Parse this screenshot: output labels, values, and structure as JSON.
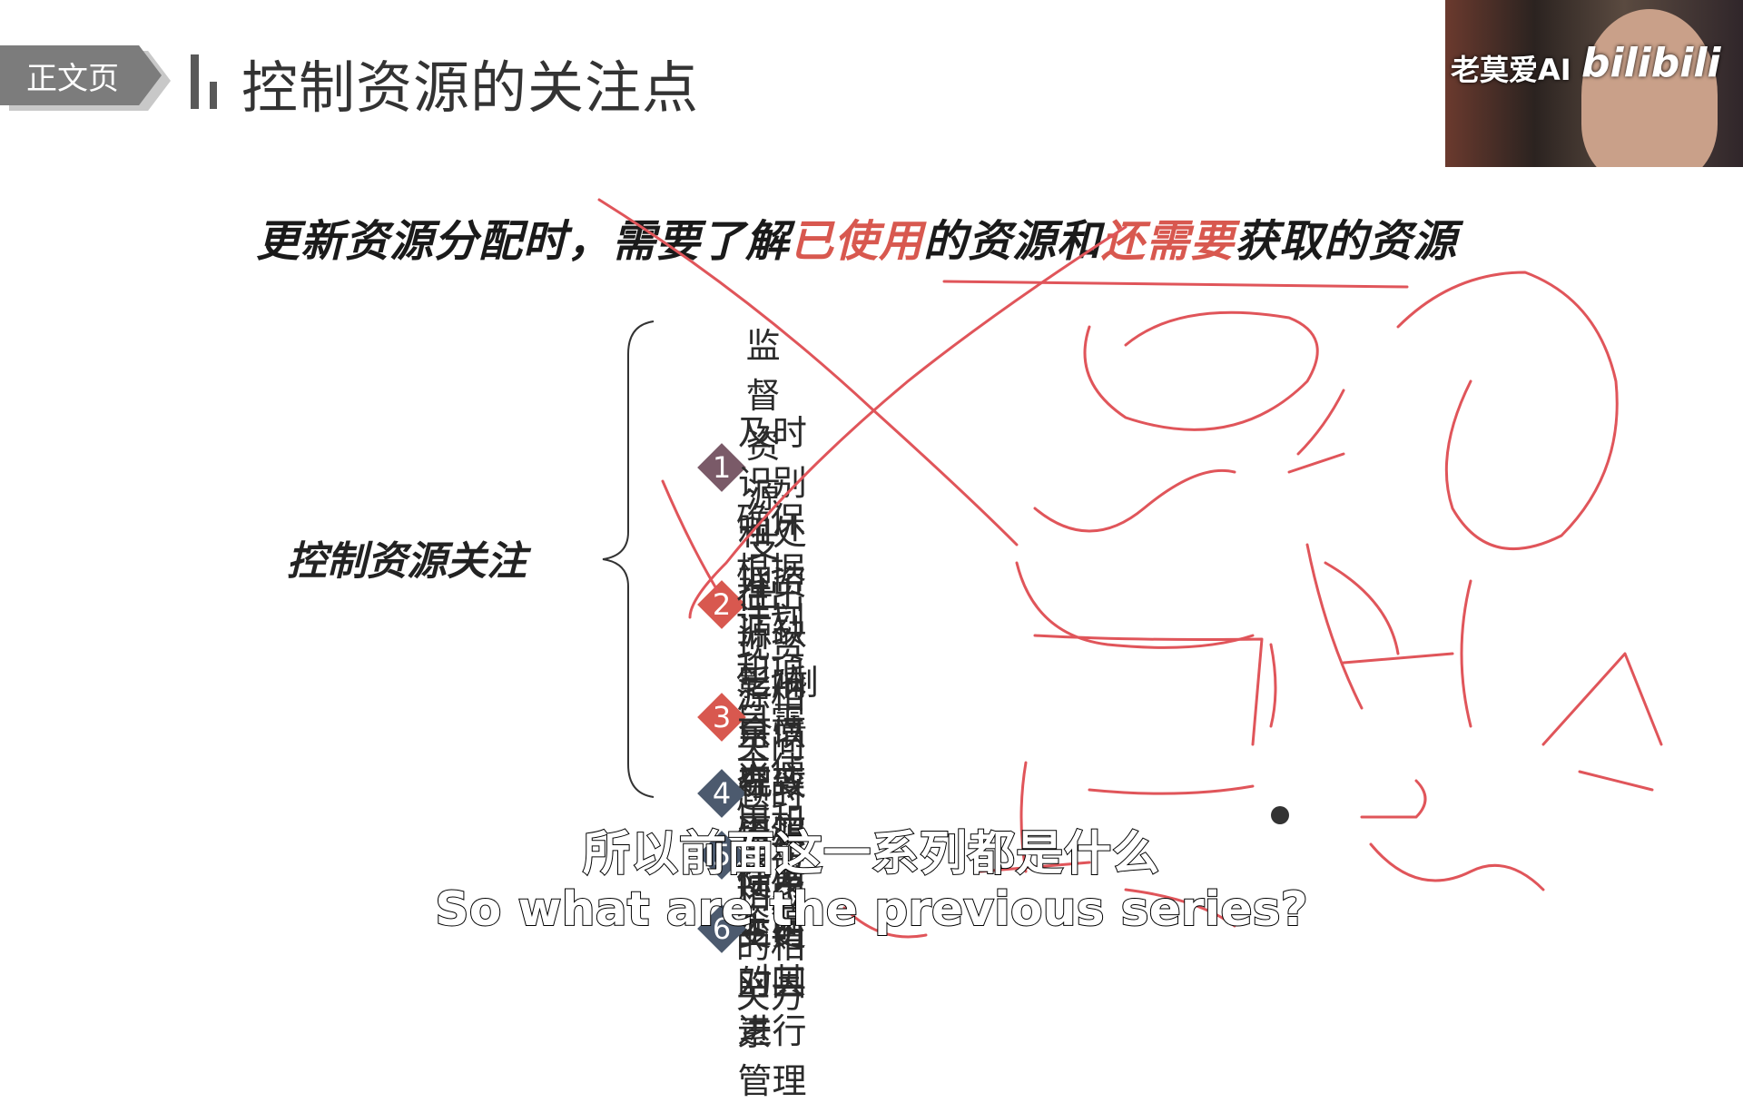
{
  "slide": {
    "tag": "正文页",
    "title": "控制资源的关注点",
    "headline": {
      "part1": "更新资源分配时，需要了解",
      "hl1": "已使用",
      "part2": "的资源和",
      "hl2": "还需要",
      "part3": "获取的资源"
    },
    "group_label": "控制资源关注",
    "items": [
      {
        "num": "1",
        "text": "监督资源支出",
        "color": "#7a5a68"
      },
      {
        "num": "2",
        "text": "及时识别和处理资源缺乏/剩余情况",
        "color": "#d8584f"
      },
      {
        "num": "3",
        "text": "确保根据计划和项目需求使用和释放资源",
        "color": "#d8584f"
      },
      {
        "num": "4",
        "text": "在出现资源相关问题时通知相应的相关方",
        "color": "#4c5a6e"
      },
      {
        "num": "5",
        "text": "影响可以导致资源使用变更的因素",
        "color": "#4c5a6e"
      },
      {
        "num": "6",
        "text": "在变更实际发生时对其进行管理",
        "color": "#4c5a6e"
      }
    ],
    "accent_color": "#d8584f"
  },
  "webcam": {
    "brand": "老莫爱AI",
    "platform": "bilibili"
  },
  "subtitles": {
    "cn": "所以前面这一系列都是什么",
    "en": "So what are the previous series?"
  }
}
